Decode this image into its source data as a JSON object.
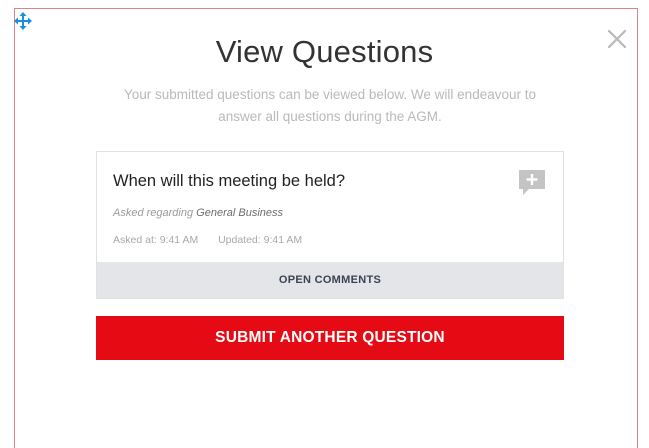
{
  "modal": {
    "title": "View Questions",
    "subtitle": "Your submitted questions can be viewed below. We will endeavour to answer all questions during the AGM.",
    "close_icon": "close-icon",
    "move_icon": "move-icon"
  },
  "question": {
    "text": "When will this meeting be held?",
    "asked_regarding_label": "Asked regarding",
    "topic": "General Business",
    "asked_at_label": "Asked at:",
    "asked_at": "9:41 AM",
    "updated_label": "Updated:",
    "updated_at": "9:41 AM",
    "comment_icon": "add-comment-icon",
    "open_comments_label": "OPEN COMMENTS"
  },
  "actions": {
    "submit_another_label": "SUBMIT ANOTHER QUESTION"
  },
  "colors": {
    "accent": "#e60a14",
    "move_icon": "#1a8fe0",
    "comment_icon": "#c4c4c4",
    "comments_bar": "#e4e5e8"
  }
}
